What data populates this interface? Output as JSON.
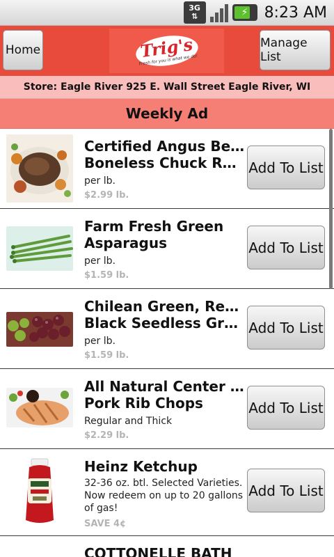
{
  "status": {
    "network": "3G",
    "time": "8:23 AM"
  },
  "header": {
    "home_label": "Home",
    "manage_label": "Manage List",
    "logo_text": "Trig's",
    "logo_tagline": "Fresh for you is what we do!"
  },
  "store_line": "Store: Eagle River 925 E. Wall Street Eagle River, WI",
  "section_title": "Weekly Ad",
  "items": [
    {
      "title_line1": "Certified Angus Beef",
      "title_line2": "Boneless Chuck Roas...",
      "desc": "per lb.",
      "price": "$2.99 lb.",
      "button": "Add To List",
      "image": "beef-roast"
    },
    {
      "title_line1": "Farm Fresh Green",
      "title_line2": "Asparagus",
      "desc": "per lb.",
      "price": "$1.59 lb.",
      "button": "Add To List",
      "image": "asparagus"
    },
    {
      "title_line1": "Chilean Green, Red or",
      "title_line2": "Black Seedless Grape...",
      "desc": "per lb.",
      "price": "$1.59 lb.",
      "button": "Add To List",
      "image": "grapes"
    },
    {
      "title_line1": "All Natural Center Cut",
      "title_line2": "Pork Rib Chops",
      "desc": "Regular and Thick",
      "price": "$2.29 lb.",
      "button": "Add To List",
      "image": "pork-chops"
    },
    {
      "title_line1": "Heinz Ketchup",
      "title_line2": "",
      "desc": "32-36 oz. btl. Selected Varieties. Now redeem on up to 20 gallons of gas!",
      "price": "SAVE 4¢",
      "button": "Add To List",
      "image": "ketchup-bottle"
    },
    {
      "title_line1": "COTTONELLE BATH",
      "title_line2": "",
      "desc": "",
      "price": "",
      "button": "",
      "image": ""
    }
  ]
}
